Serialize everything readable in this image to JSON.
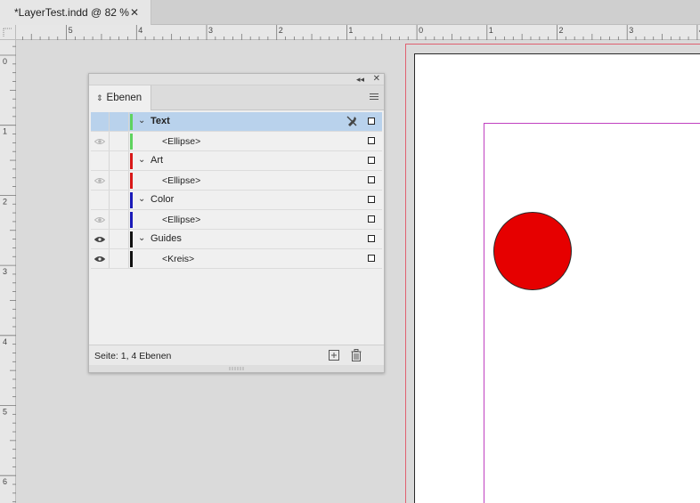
{
  "document_tab": {
    "title": "*LayerTest.indd @ 82 %",
    "close_glyph": "✕"
  },
  "rulers": {
    "top_labels": [
      "5",
      "4",
      "3",
      "2",
      "1",
      "0",
      "1",
      "2",
      "3",
      "4"
    ],
    "left_labels": [
      "0",
      "1",
      "2",
      "3",
      "4",
      "5",
      "6"
    ]
  },
  "layers_panel": {
    "tab_label": "Ebenen",
    "collapse_glyph": "◂◂",
    "close_glyph": "✕",
    "layers": [
      {
        "name": "Text",
        "color": "#5fd35f",
        "expanded": true,
        "selected": true
      },
      {
        "name": "Art",
        "color": "#d81818",
        "expanded": true,
        "selected": false
      },
      {
        "name": "Color",
        "color": "#1a1ab8",
        "expanded": true,
        "selected": false
      },
      {
        "name": "Guides",
        "color": "#111111",
        "expanded": true,
        "selected": false
      }
    ],
    "sublayers": [
      {
        "name": "<Ellipse>",
        "parent": "Text",
        "visible_icon": "dim"
      },
      {
        "name": "<Ellipse>",
        "parent": "Art",
        "visible_icon": "dim"
      },
      {
        "name": "<Ellipse>",
        "parent": "Color",
        "visible_icon": "dim"
      },
      {
        "name": "<Kreis>",
        "parent": "Guides",
        "visible_icon": "solid"
      }
    ],
    "status_text": "Seite: 1, 4 Ebenen"
  },
  "canvas": {
    "circle_fill": "#e60000",
    "bleed_color": "#e06070",
    "margin_color": "#c040c0"
  }
}
